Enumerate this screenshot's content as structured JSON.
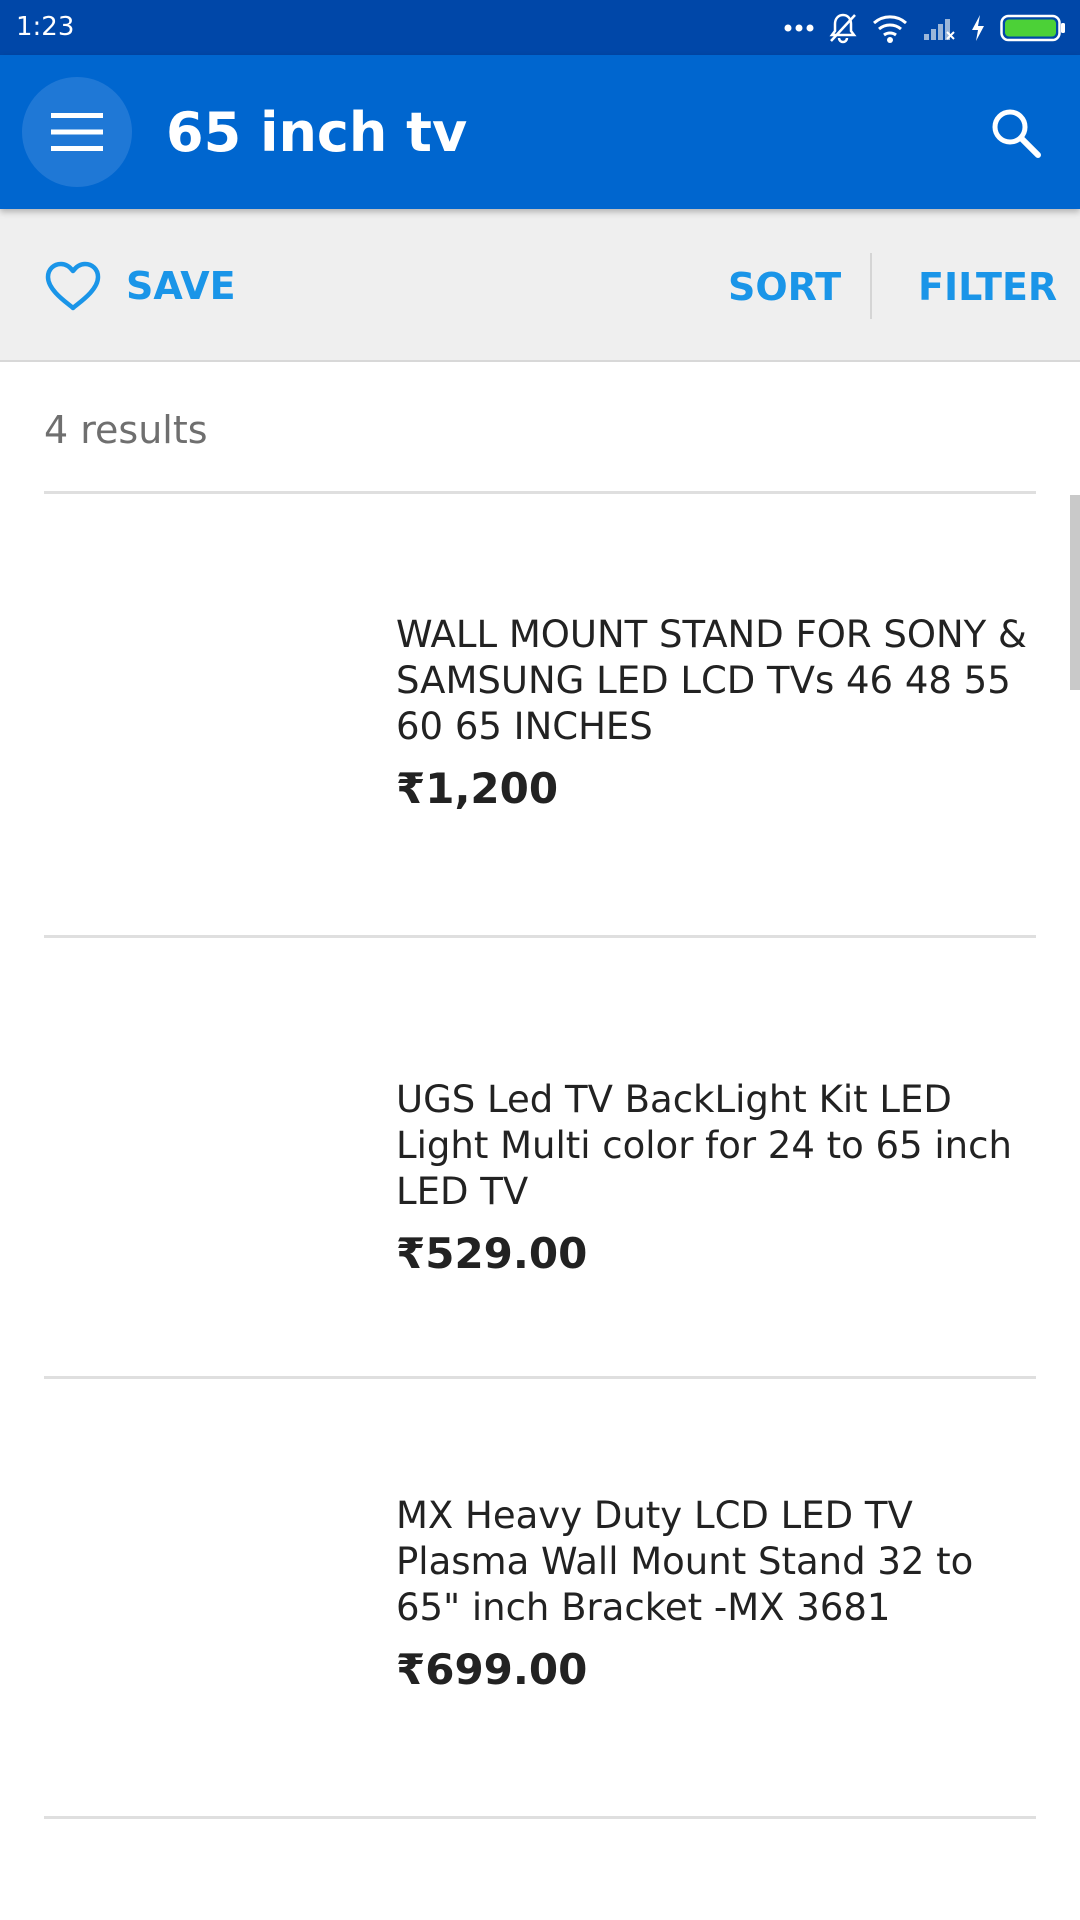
{
  "status_bar": {
    "time": "1:23"
  },
  "app_bar": {
    "title": "65 inch tv",
    "menu_icon": "hamburger-menu-icon",
    "search_icon": "search-icon",
    "color": "#0066cf"
  },
  "toolbar": {
    "save_label": "SAVE",
    "sort_label": "SORT",
    "filter_label": "FILTER",
    "accent_color": "#1a95e8"
  },
  "results": {
    "count_text": "4 results",
    "items": [
      {
        "title": "WALL MOUNT STAND FOR SONY & SAMSUNG LED LCD TVs 46 48 55 60 65 INCHES",
        "price": "₹1,200"
      },
      {
        "title": "UGS Led TV BackLight Kit LED Light Multi color for 24 to 65 inch LED TV",
        "price": "₹529.00"
      },
      {
        "title": "MX Heavy Duty LCD LED TV Plasma Wall Mount Stand 32 to 65\" inch Bracket -MX 3681",
        "price": "₹699.00"
      }
    ]
  }
}
